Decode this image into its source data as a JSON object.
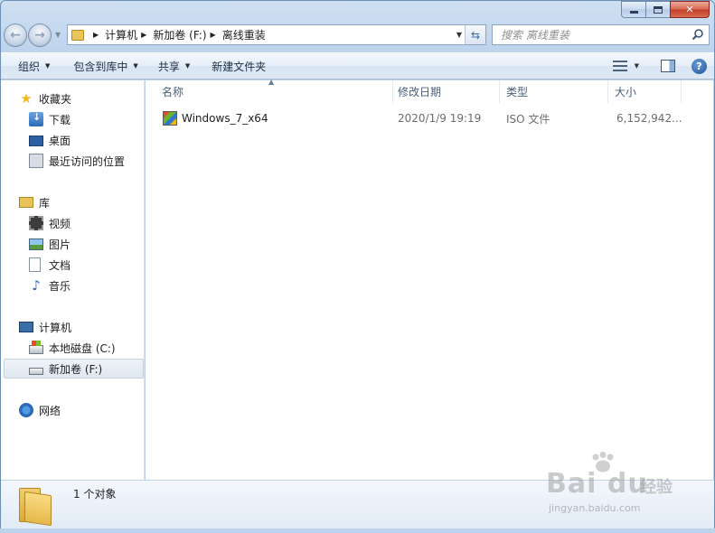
{
  "window": {
    "caption": {
      "minimize": "",
      "maximize": "",
      "close": "✕"
    }
  },
  "address_bar": {
    "crumbs": [
      "计算机",
      "新加卷 (F:)",
      "离线重装"
    ]
  },
  "search": {
    "placeholder": "搜索 离线重装"
  },
  "toolbar": {
    "organize": "组织",
    "include_in_library": "包含到库中",
    "share": "共享",
    "new_folder": "新建文件夹"
  },
  "nav_pane": {
    "favorites": {
      "label": "收藏夹",
      "items": [
        "下载",
        "桌面",
        "最近访问的位置"
      ]
    },
    "libraries": {
      "label": "库",
      "items": [
        "视频",
        "图片",
        "文档",
        "音乐"
      ]
    },
    "computer": {
      "label": "计算机",
      "items": [
        "本地磁盘 (C:)",
        "新加卷 (F:)"
      ],
      "selected": "新加卷 (F:)"
    },
    "network": {
      "label": "网络"
    }
  },
  "file_list": {
    "columns": [
      "名称",
      "修改日期",
      "类型",
      "大小"
    ],
    "rows": [
      {
        "name": "Windows_7_x64",
        "modified": "2020/1/9 19:19",
        "type": "ISO 文件",
        "size": "6,152,942..."
      }
    ]
  },
  "details_pane": {
    "summary": "1 个对象"
  },
  "watermark": {
    "brand": "Bai du",
    "brand_cn": "经验",
    "url": "jingyan.baidu.com"
  },
  "colors": {
    "frame": "#bcd3ec",
    "accent": "#3a6ea8",
    "close": "#c4402a"
  }
}
